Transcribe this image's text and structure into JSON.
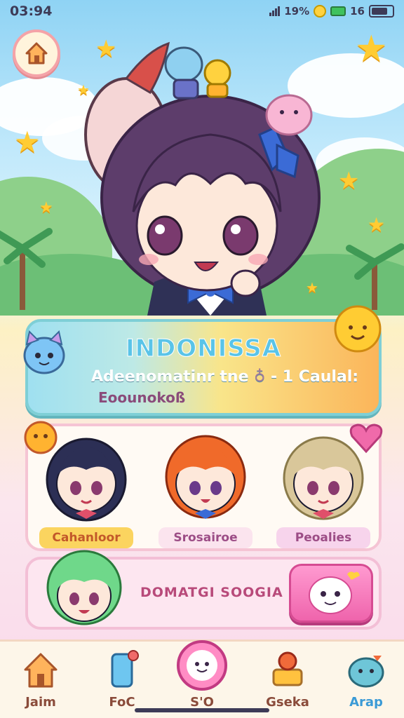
{
  "status": {
    "time": "03:94",
    "signal": "19%",
    "network": "16"
  },
  "banner": {
    "title": "INDONISSA",
    "subtitle": "Adeenomatinr tne",
    "value": "- 1 Caulal:",
    "subtitle2": "Eoounokoß"
  },
  "characters": [
    {
      "label": "Cahanloor",
      "hair": "#2c2f55",
      "tag_bg": "#fbd45f",
      "tag_color": "#c2582a"
    },
    {
      "label": "Srosairoe",
      "hair": "#f06a2a",
      "tag_bg": "#fbe4ee",
      "tag_color": "#9c4d86"
    },
    {
      "label": "Peoalies",
      "hair": "#d9c79a",
      "tag_bg": "#f7d4ec",
      "tag_color": "#9c4d86"
    }
  ],
  "donate": {
    "label": "DOMATGI SOOGIA"
  },
  "nav": [
    {
      "label": "Jaim",
      "icon": "house-icon"
    },
    {
      "label": "FoC",
      "icon": "phone-icon"
    },
    {
      "label": "S'O",
      "icon": "smiley-icon"
    },
    {
      "label": "Gseka",
      "icon": "balloon-icon"
    },
    {
      "label": "Arap",
      "icon": "mascot-icon"
    }
  ],
  "colors": {
    "accent": "#ef64ac",
    "banner_title": "#5ac4e8",
    "nav_text": "#8a4b3a"
  }
}
